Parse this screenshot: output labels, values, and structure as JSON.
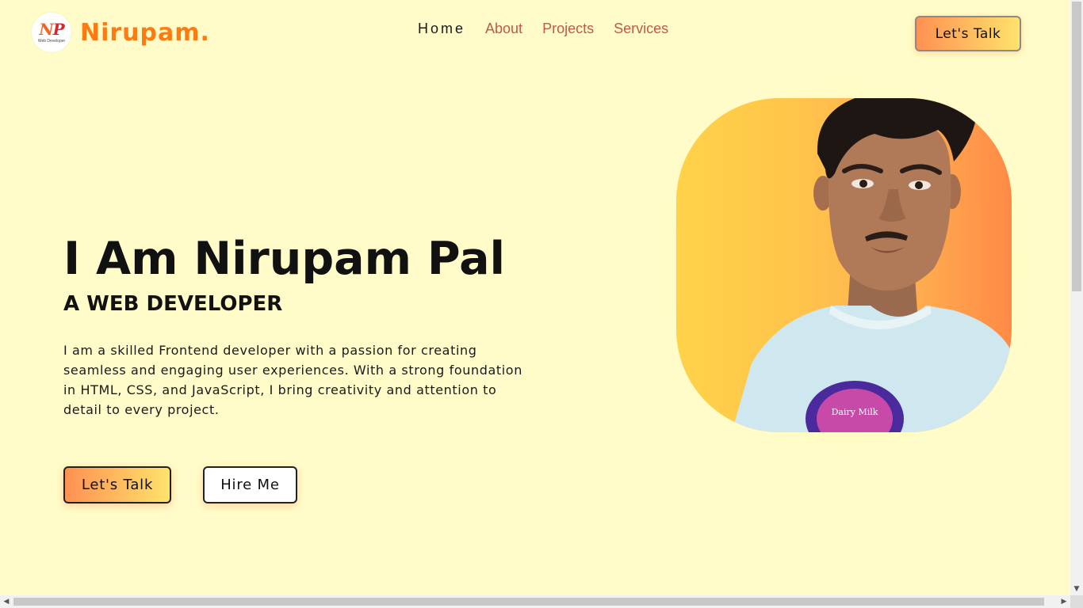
{
  "brand": {
    "logo_letters": "NP",
    "logo_caption": "Web Developer",
    "name": "Nirupam."
  },
  "nav": {
    "items": [
      {
        "label": "Home",
        "active": true
      },
      {
        "label": "About",
        "active": false
      },
      {
        "label": "Projects",
        "active": false
      },
      {
        "label": "Services",
        "active": false
      }
    ],
    "cta_label": "Let's Talk"
  },
  "hero": {
    "title": "I Am Nirupam Pal",
    "subtitle": "A WEB DEVELOPER",
    "description": "I am a skilled Frontend developer with a passion for creating seamless and engaging user experiences. With a strong foundation in HTML, CSS, and JavaScript, I bring creativity and attention to detail to every project.",
    "primary_button": "Let's Talk",
    "secondary_button": "Hire Me"
  },
  "portrait": {
    "shirt_print_text": "Dairy Milk",
    "icon": "person-photo"
  },
  "colors": {
    "background": "#fffcc9",
    "brand": "#ff7a0f",
    "nav_link": "#c05a47",
    "gradient_start": "#ff9153",
    "gradient_end": "#ffe36b"
  }
}
